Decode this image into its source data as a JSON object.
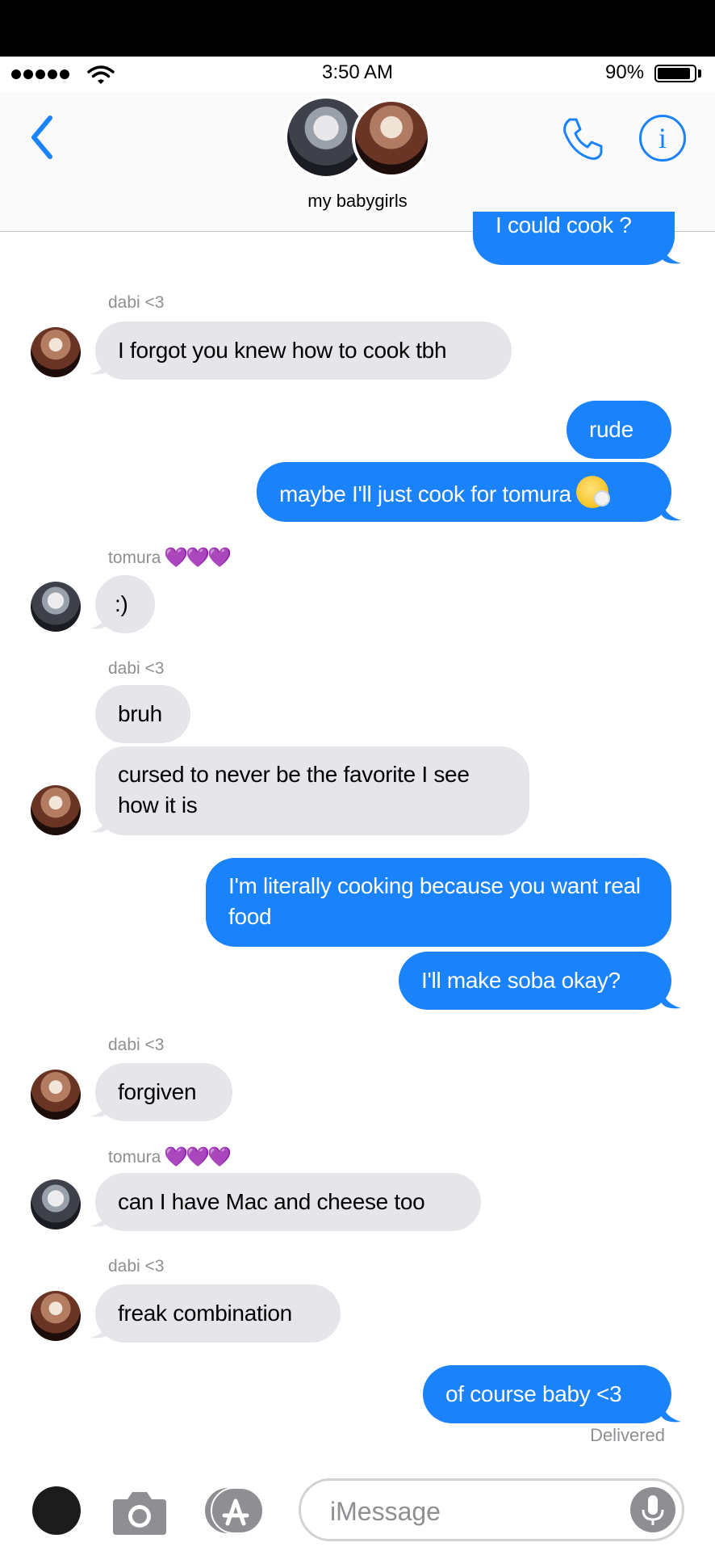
{
  "status_bar": {
    "time": "3:50 AM",
    "battery": "90%",
    "battery_level": 0.9
  },
  "header": {
    "group_name": "my babygirls"
  },
  "messages": [
    {
      "type": "out",
      "text": "I could cook ?"
    },
    {
      "type": "sender",
      "name": "dabi <3"
    },
    {
      "type": "in",
      "from": "dabi",
      "text": "I forgot you knew how to cook tbh"
    },
    {
      "type": "out",
      "text": "rude"
    },
    {
      "type": "out",
      "text": "maybe I'll just cook for tomura",
      "emoji": "sneezing-face-emoji"
    },
    {
      "type": "sender",
      "name": "tomura",
      "hearts": "💜💜💜"
    },
    {
      "type": "in",
      "from": "tomura",
      "text": ":)"
    },
    {
      "type": "sender",
      "name": "dabi <3"
    },
    {
      "type": "in",
      "from": "dabi",
      "text": "bruh"
    },
    {
      "type": "in",
      "from": "dabi",
      "text": "cursed to never be the favorite I see how it is"
    },
    {
      "type": "out",
      "text": "I'm literally cooking because you want real food"
    },
    {
      "type": "out",
      "text": "I'll make soba okay?"
    },
    {
      "type": "sender",
      "name": "dabi <3"
    },
    {
      "type": "in",
      "from": "dabi",
      "text": "forgiven"
    },
    {
      "type": "sender",
      "name": "tomura",
      "hearts": "💜💜💜"
    },
    {
      "type": "in",
      "from": "tomura",
      "text": "can I have Mac and cheese too"
    },
    {
      "type": "sender",
      "name": "dabi <3"
    },
    {
      "type": "in",
      "from": "dabi",
      "text": "freak combination"
    },
    {
      "type": "out",
      "text": "of course baby <3"
    }
  ],
  "delivered": "Delivered",
  "input": {
    "placeholder": "iMessage"
  },
  "colors": {
    "outgoing": "#1a82fb",
    "incoming": "#e5e5ea",
    "accent": "#1a82fb",
    "hearts": "#9b3fe6"
  }
}
